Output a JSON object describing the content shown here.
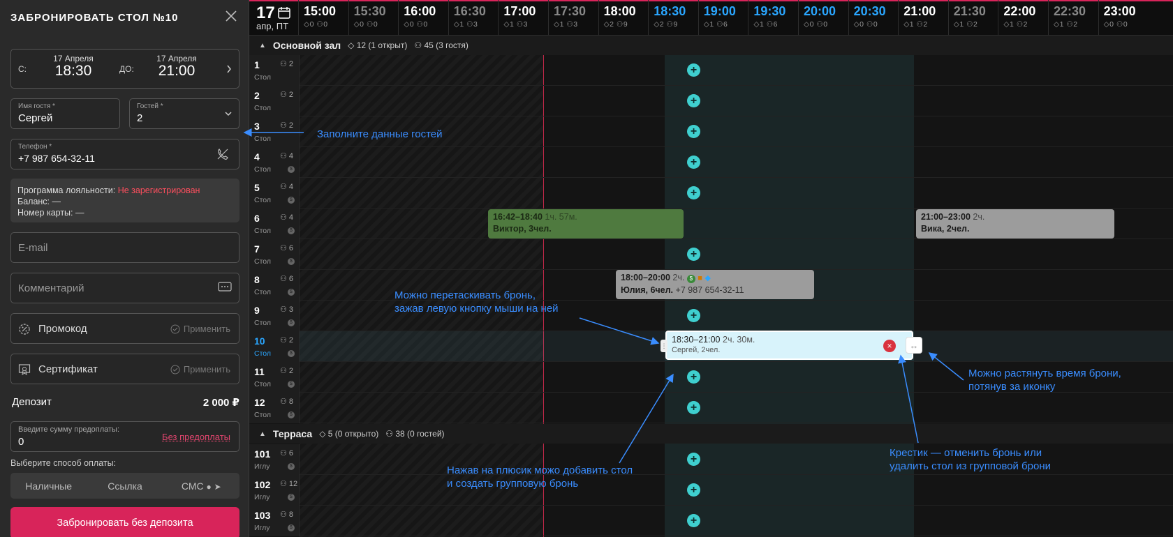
{
  "panel": {
    "title": "ЗАБРОНИРОВАТЬ СТОЛ №10",
    "from_label": "С:",
    "from_date": "17 Апреля",
    "from_time": "18:30",
    "to_label": "ДО:",
    "to_date": "17 Апреля",
    "to_time": "21:00",
    "guest_name_label": "Имя гостя *",
    "guest_name": "Сергей",
    "guests_label": "Гостей *",
    "guests": "2",
    "phone_label": "Телефон *",
    "phone": "+7 987 654-32-11",
    "loyalty_label": "Программа лояльности:",
    "loyalty_status": "Не зарегистрирован",
    "balance": "Баланс: —",
    "card": "Номер карты: —",
    "email_placeholder": "E-mail",
    "comment_placeholder": "Комментарий",
    "promo_label": "Промокод",
    "cert_label": "Сертификат",
    "apply_label": "Применить",
    "deposit_label": "Депозит",
    "deposit_value": "2 000 ₽",
    "prepay_label": "Введите сумму предоплаты:",
    "prepay_value": "0",
    "no_prepay": "Без предоплаты",
    "pay_method_label": "Выберите способ оплаты:",
    "pay_methods": [
      "Наличные",
      "Ссылка",
      "СМС"
    ],
    "submit_label": "Забронировать без депозита"
  },
  "timeline": {
    "day": "17",
    "day_sub": "апр, ПТ",
    "times": [
      {
        "t": "15:00",
        "c": "◇0 ⚇0"
      },
      {
        "t": "15:30",
        "c": "◇0 ⚇0"
      },
      {
        "t": "16:00",
        "c": "◇0 ⚇0"
      },
      {
        "t": "16:30",
        "c": "◇1 ⚇3"
      },
      {
        "t": "17:00",
        "c": "◇1 ⚇3"
      },
      {
        "t": "17:30",
        "c": "◇1 ⚇3"
      },
      {
        "t": "18:00",
        "c": "◇2 ⚇9"
      },
      {
        "t": "18:30",
        "c": "◇2 ⚇9"
      },
      {
        "t": "19:00",
        "c": "◇1 ⚇6"
      },
      {
        "t": "19:30",
        "c": "◇1 ⚇6"
      },
      {
        "t": "20:00",
        "c": "◇0 ⚇0"
      },
      {
        "t": "20:30",
        "c": "◇0 ⚇0"
      },
      {
        "t": "21:00",
        "c": "◇1 ⚇2"
      },
      {
        "t": "21:30",
        "c": "◇1 ⚇2"
      },
      {
        "t": "22:00",
        "c": "◇1 ⚇2"
      },
      {
        "t": "22:30",
        "c": "◇1 ⚇2"
      },
      {
        "t": "23:00",
        "c": "◇0 ⚇0"
      }
    ]
  },
  "sections": {
    "main": {
      "name": "Основной зал",
      "tables": "12 (1 открыт)",
      "guests": "45 (3 гостя)"
    },
    "terrace": {
      "name": "Терраса",
      "tables": "5 (0 открыто)",
      "guests": "38 (0 гостей)"
    }
  },
  "rows": [
    {
      "n": "1",
      "s": "Стол",
      "cap": "2"
    },
    {
      "n": "2",
      "s": "Стол",
      "cap": "2"
    },
    {
      "n": "3",
      "s": "Стол",
      "cap": "2"
    },
    {
      "n": "4",
      "s": "Стол",
      "cap": "4"
    },
    {
      "n": "5",
      "s": "Стол",
      "cap": "4"
    },
    {
      "n": "6",
      "s": "Стол",
      "cap": "4"
    },
    {
      "n": "7",
      "s": "Стол",
      "cap": "6"
    },
    {
      "n": "8",
      "s": "Стол",
      "cap": "6"
    },
    {
      "n": "9",
      "s": "Стол",
      "cap": "3"
    },
    {
      "n": "10",
      "s": "Стол",
      "cap": "2"
    },
    {
      "n": "11",
      "s": "Стол",
      "cap": "2"
    },
    {
      "n": "12",
      "s": "Стол",
      "cap": "8"
    },
    {
      "n": "101",
      "s": "Иглу",
      "cap": "6"
    },
    {
      "n": "102",
      "s": "Иглу",
      "cap": "12"
    },
    {
      "n": "103",
      "s": "Иглу",
      "cap": "8"
    }
  ],
  "bookings": {
    "b1_time": "16:42–18:40",
    "b1_dur": "1ч. 57м.",
    "b1_name": "Виктор, 3чел.",
    "b2_time": "21:00–23:00",
    "b2_dur": "2ч.",
    "b2_name": "Вика, 2чел.",
    "b3_time": "18:00–20:00",
    "b3_dur": "2ч.",
    "b3_name": "Юлия, 6чел.",
    "b3_phone": "+7 987 654-32-11",
    "b4_time": "18:30–21:00",
    "b4_dur": "2ч. 30м.",
    "b4_name": "Сергей, 2чел."
  },
  "annotations": {
    "a1": "Заполните данные гостей",
    "a2_l1": "Можно перетаскивать бронь,",
    "a2_l2": "зажав левую кнопку мыши на ней",
    "a3_l1": "Можно растянуть время брони,",
    "a3_l2": "потянув за иконку",
    "a4_l1": "Нажав на плюсик можо добавить стол",
    "a4_l2": "и создать групповую бронь",
    "a5_l1": "Крестик — отменить бронь или",
    "a5_l2": "удалить стол из групповой брони"
  },
  "colors": {
    "accent": "#d8245a",
    "cyan": "#3fcfcf",
    "annotation": "#3a8dff",
    "highlight": "#2aa6ff"
  }
}
